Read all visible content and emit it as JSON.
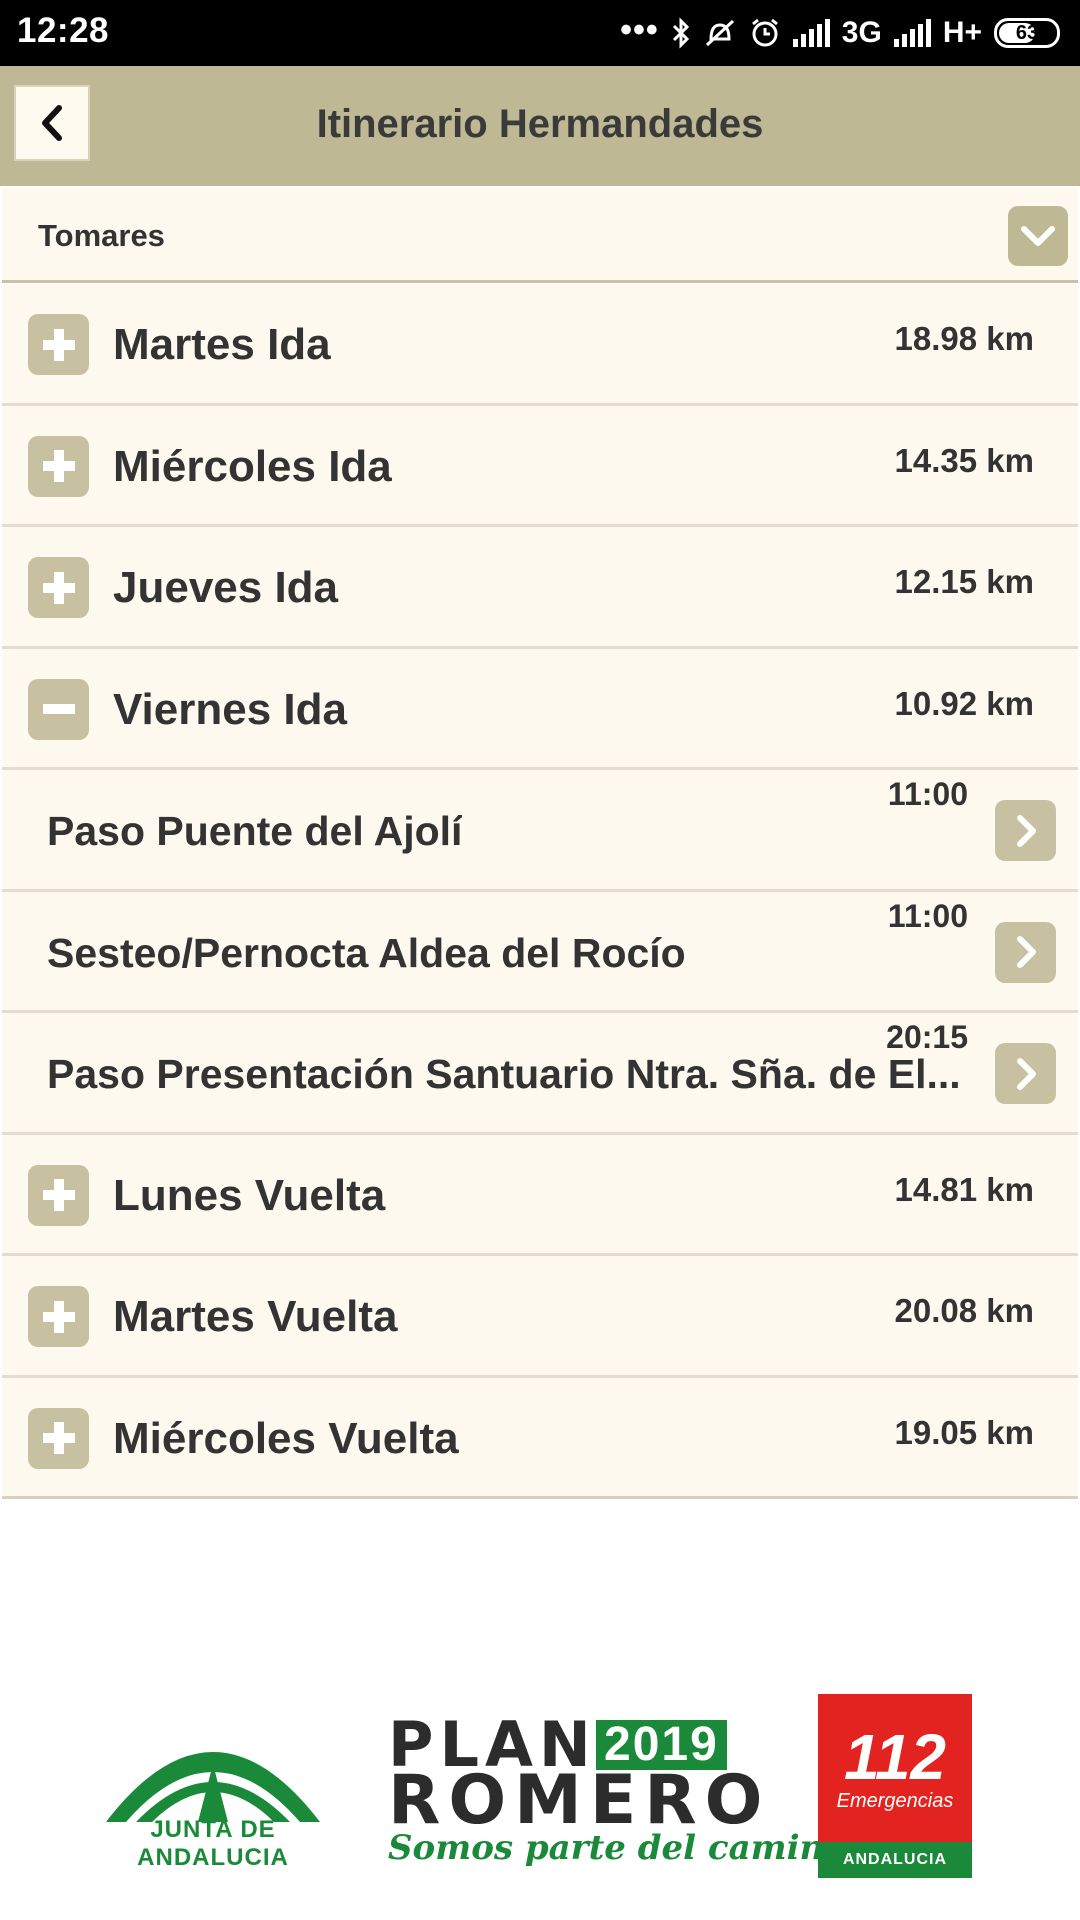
{
  "status_bar": {
    "time": "12:28",
    "network_1": "3G",
    "network_2": "H+",
    "battery": "63"
  },
  "header": {
    "title": "Itinerario Hermandades"
  },
  "selector": {
    "value": "Tomares"
  },
  "itinerary": {
    "days": [
      {
        "label": "Martes Ida",
        "distance": "18.98 km",
        "expanded": false
      },
      {
        "label": "Miércoles Ida",
        "distance": "14.35 km",
        "expanded": false
      },
      {
        "label": "Jueves Ida",
        "distance": "12.15 km",
        "expanded": false
      },
      {
        "label": "Viernes Ida",
        "distance": "10.92 km",
        "expanded": true
      },
      {
        "label": "Lunes Vuelta",
        "distance": "14.81 km",
        "expanded": false
      },
      {
        "label": "Martes Vuelta",
        "distance": "20.08 km",
        "expanded": false
      },
      {
        "label": "Miércoles Vuelta",
        "distance": "19.05 km",
        "expanded": false
      }
    ],
    "stops": [
      {
        "label": "Paso Puente del Ajolí",
        "time": "11:00"
      },
      {
        "label": "Sesteo/Pernocta Aldea del Rocío",
        "time": "11:00"
      },
      {
        "label": "Paso Presentación Santuario Ntra. Sña. de El...",
        "time": "20:15"
      }
    ]
  },
  "footer": {
    "junta_text": "JUNTA DE ANDALUCIA",
    "plan_word": "PLAN",
    "plan_year": "2019",
    "romero_word": "ROMERO",
    "slogan": "Somos parte del camino",
    "emergency_number": "112",
    "emergency_label": "Emergencias",
    "emergency_region": "ANDALUCIA"
  },
  "colors": {
    "header_bg": "#bfb894",
    "row_bg": "#fdf9ef",
    "icon_bg": "#c7c1a2",
    "brand_green": "#1a8a3a",
    "brand_red": "#e3231f"
  }
}
